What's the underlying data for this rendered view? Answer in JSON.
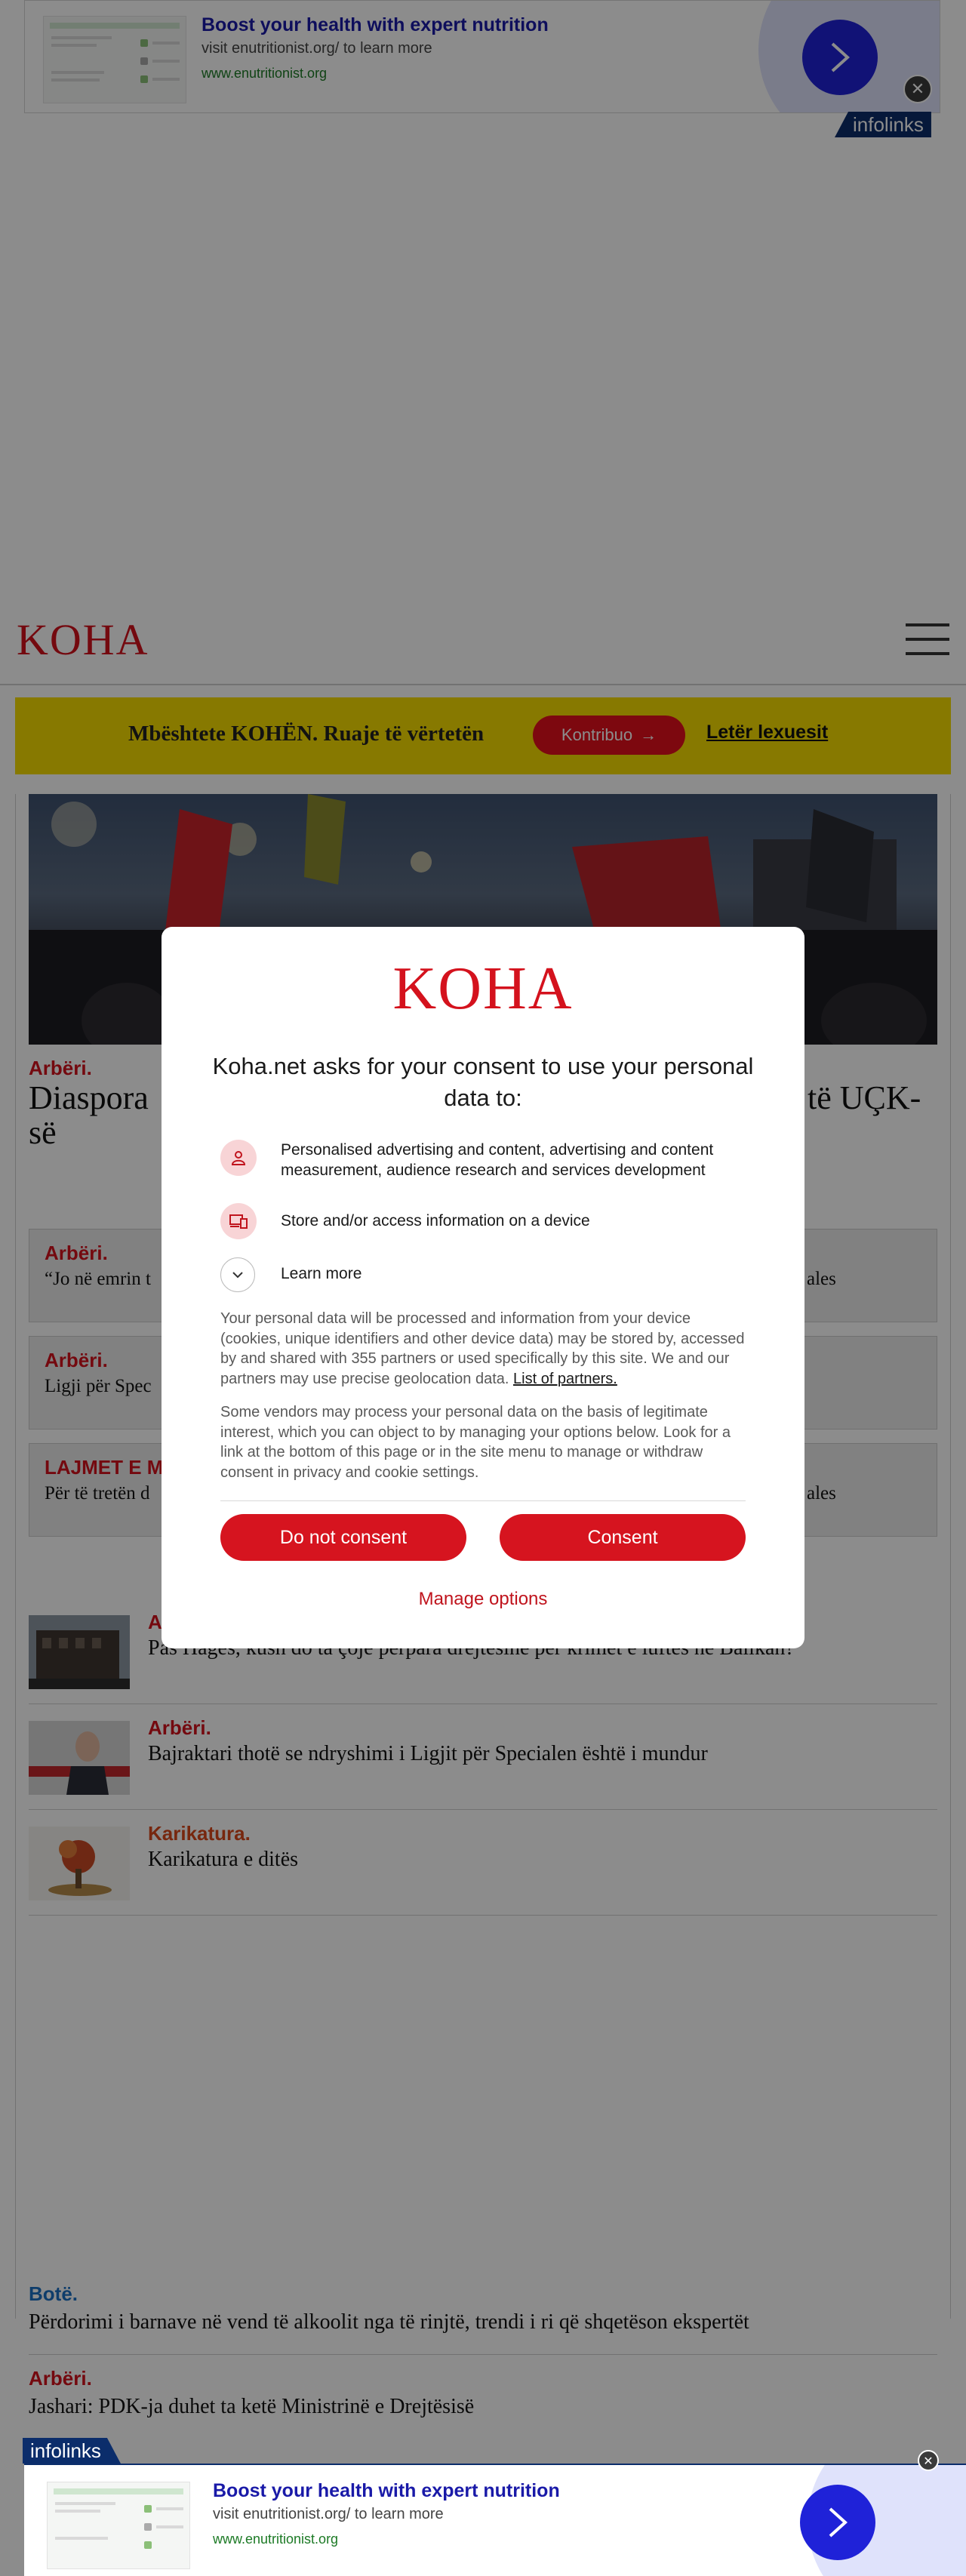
{
  "ad": {
    "title": "Boost your health with expert nutrition",
    "subtitle": "visit enutritionist.org/ to learn more",
    "url": "www.enutritionist.org",
    "network": "infolinks",
    "close_glyph": "✕"
  },
  "site": {
    "logo": "KOHA",
    "menu_icon": "hamburger-menu-icon"
  },
  "support": {
    "text": "Mbështete KOHËN. Ruaje të vërtetën",
    "contribute_label": "Kontribuo",
    "contribute_arrow": "→",
    "letter_link": "Letër lexuesit"
  },
  "hero": {
    "category": "Arbëri.",
    "title_left": "Diaspora",
    "title_right": "të UÇK-",
    "title_line2": "së"
  },
  "cards": [
    {
      "category": "Arbëri.",
      "text": "“Jo në emrin t",
      "text_right": "ales"
    },
    {
      "category": "Arbëri.",
      "text": "Ligji për Spec",
      "text_right": ""
    },
    {
      "category": "LAJMET E M",
      "text": "Për të tretën d",
      "text_right": "ales"
    }
  ],
  "news": [
    {
      "category": "A",
      "title": "Pas Hages, kush do ta çojë përpara drejtësinë për krimet e luftës në Ballkan?"
    },
    {
      "category": "Arbëri.",
      "title": "Bajraktari thotë se ndryshimi i Ligjit për Specialen është i mundur"
    },
    {
      "category": "Karikatura.",
      "title": "Karikatura e ditës"
    }
  ],
  "bottom": [
    {
      "category": "Botë.",
      "title": "Përdorimi i barnave në vend të alkoolit nga të rinjtë, trendi i ri që shqetëson ekspertët"
    },
    {
      "category": "Arbëri.",
      "title": "Jashari: PDK-ja duhet ta ketë Ministrinë e Drejtësisë"
    }
  ],
  "consent": {
    "logo": "KOHA",
    "heading": "Koha.net asks for your consent to use your personal data to:",
    "purposes": [
      "Personalised advertising and content, advertising and content measurement, audience research and services development",
      "Store and/or access information on a device"
    ],
    "learn_more": "Learn more",
    "para1": "Your personal data will be processed and information from your device (cookies, unique identifiers and other device data) may be stored by, accessed by and shared with 355 partners or used specifically by this site. We and our partners may use precise geolocation data.",
    "partners_link": "List of partners.",
    "para2": "Some vendors may process your personal data on the basis of legitimate interest, which you can object to by managing your options below. Look for a link at the bottom of this page or in the site menu to manage or withdraw consent in privacy and cookie settings.",
    "do_not_consent": "Do not consent",
    "consent": "Consent",
    "manage": "Manage options"
  },
  "colors": {
    "brand_red": "#d4121d",
    "support_yellow": "#f6dc00",
    "ad_blue": "#1f22d8",
    "infolinks_navy": "#0b2d6b",
    "category_blue": "#1a6fc4",
    "karikatura_orange": "#d9481b"
  }
}
